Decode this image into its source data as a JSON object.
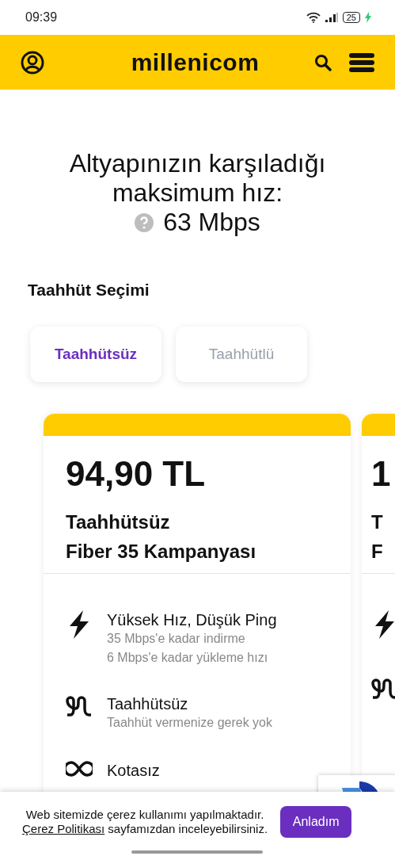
{
  "status_bar": {
    "time": "09:39",
    "battery": "25"
  },
  "header": {
    "logo": "millenicom"
  },
  "headline": {
    "text": "Altyapınızın karşıladığı maksimum hız:",
    "speed": "63 Mbps"
  },
  "commitment": {
    "title": "Taahhüt Seçimi",
    "tabs": [
      {
        "label": "Taahhütsüz",
        "selected": true
      },
      {
        "label": "Taahhütlü",
        "selected": false
      }
    ]
  },
  "plans": [
    {
      "kind": "full",
      "price": "94,90 TL",
      "name_lines": [
        "Taahhütsüz",
        "Fiber 35 Kampanyası"
      ],
      "features": [
        {
          "kind": "speed",
          "title": "Yüksek Hız, Düşük Ping",
          "details": [
            "35 Mbps'e kadar indirme",
            "6 Mbps'e kadar yükleme hızı"
          ]
        },
        {
          "kind": "commitment",
          "title": "Taahhütsüz",
          "details": [
            "Taahhüt vermenize gerek yok"
          ]
        },
        {
          "kind": "quota",
          "title": "Kotasız"
        }
      ]
    },
    {
      "kind": "partial",
      "price": "1",
      "name_lines": [
        "T",
        "F"
      ],
      "features": [
        {
          "kind": "speed"
        },
        {
          "kind": "commitment"
        }
      ]
    }
  ],
  "cookie_banner": {
    "text": "Web sitemizde çerez kullanımı yapılmaktadır.",
    "link": "Çerez Politikası",
    "text_after": "sayfamızdan inceleyebilirsiniz.",
    "button": "Anladım"
  }
}
